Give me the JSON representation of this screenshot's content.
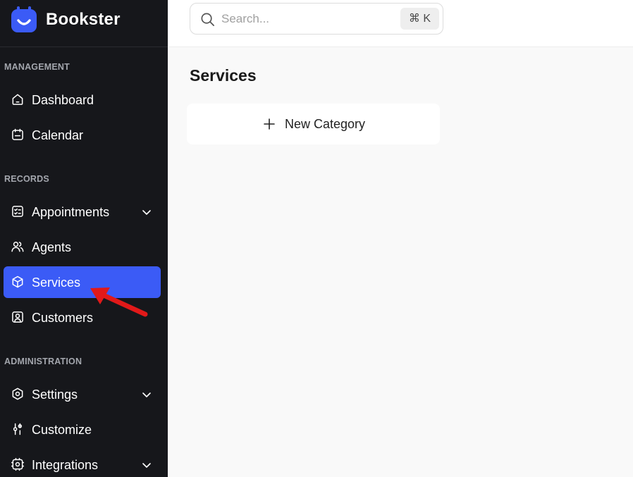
{
  "brand": {
    "name": "Bookster",
    "accent": "#3b5bf6"
  },
  "sidebar": {
    "sections": [
      {
        "title": "MANAGEMENT"
      },
      {
        "title": "RECORDS"
      },
      {
        "title": "ADMINISTRATION"
      }
    ],
    "items": [
      {
        "label": "Dashboard",
        "icon": "home-icon"
      },
      {
        "label": "Calendar",
        "icon": "calendar-icon"
      },
      {
        "label": "Appointments",
        "icon": "checklist-icon",
        "has_chevron": true
      },
      {
        "label": "Agents",
        "icon": "users-icon"
      },
      {
        "label": "Services",
        "icon": "cube-icon",
        "active": true
      },
      {
        "label": "Customers",
        "icon": "contact-icon"
      },
      {
        "label": "Settings",
        "icon": "hexagon-settings-icon",
        "has_chevron": true
      },
      {
        "label": "Customize",
        "icon": "sliders-icon"
      },
      {
        "label": "Integrations",
        "icon": "gear-icon",
        "has_chevron": true
      }
    ]
  },
  "search": {
    "placeholder": "Search...",
    "shortcut": "⌘ K"
  },
  "main": {
    "title": "Services",
    "new_category_label": "New Category"
  },
  "annotation": {
    "color": "#e11919"
  }
}
